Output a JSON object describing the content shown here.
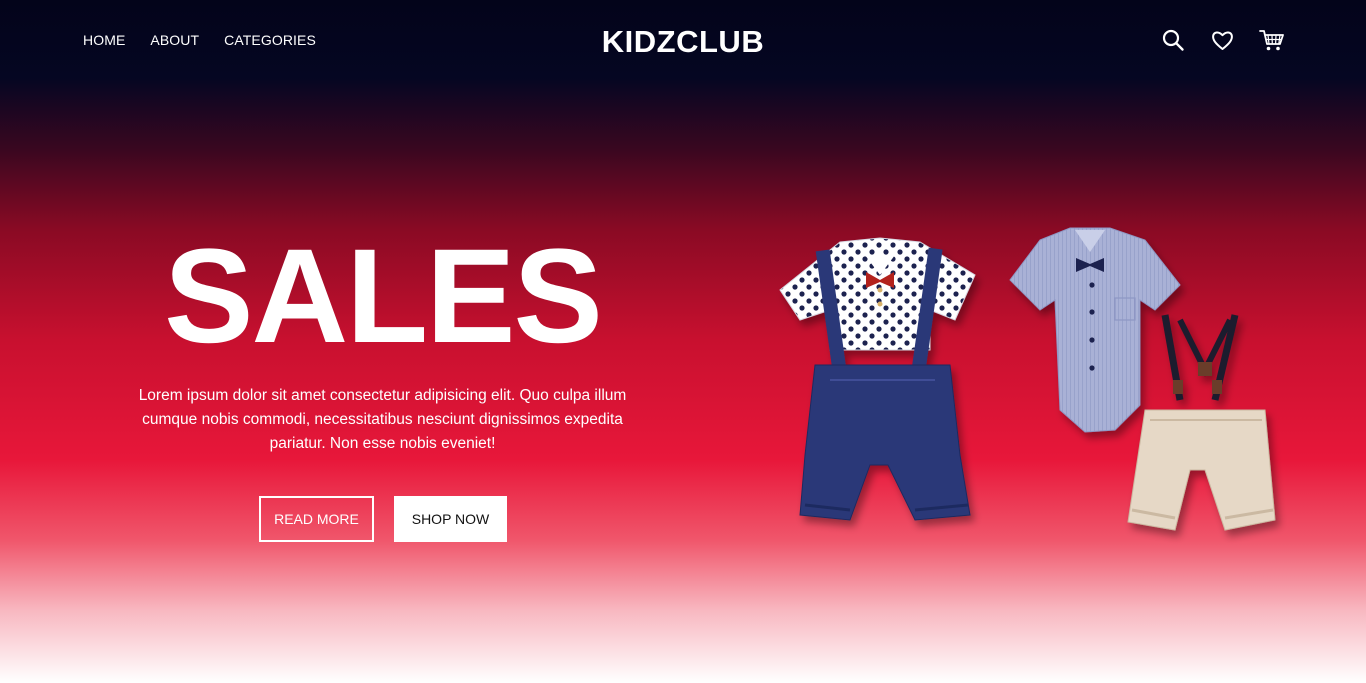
{
  "nav": {
    "links": [
      "HOME",
      "ABOUT",
      "CATEGORIES"
    ],
    "brand": "KIDZCLUB",
    "icons": [
      "search-icon",
      "heart-icon",
      "cart-icon"
    ]
  },
  "hero": {
    "title": "SALES",
    "description": "Lorem ipsum dolor sit amet consectetur adipisicing elit. Quo culpa illum cumque nobis commodi, necessitatibus nesciunt dignissimos expedita pariatur. Non esse nobis eveniet!",
    "read_more_label": "READ MORE",
    "shop_now_label": "SHOP NOW"
  },
  "colors": {
    "nav_background": "#050622",
    "accent_red": "#e8173a",
    "text": "#ffffff"
  }
}
